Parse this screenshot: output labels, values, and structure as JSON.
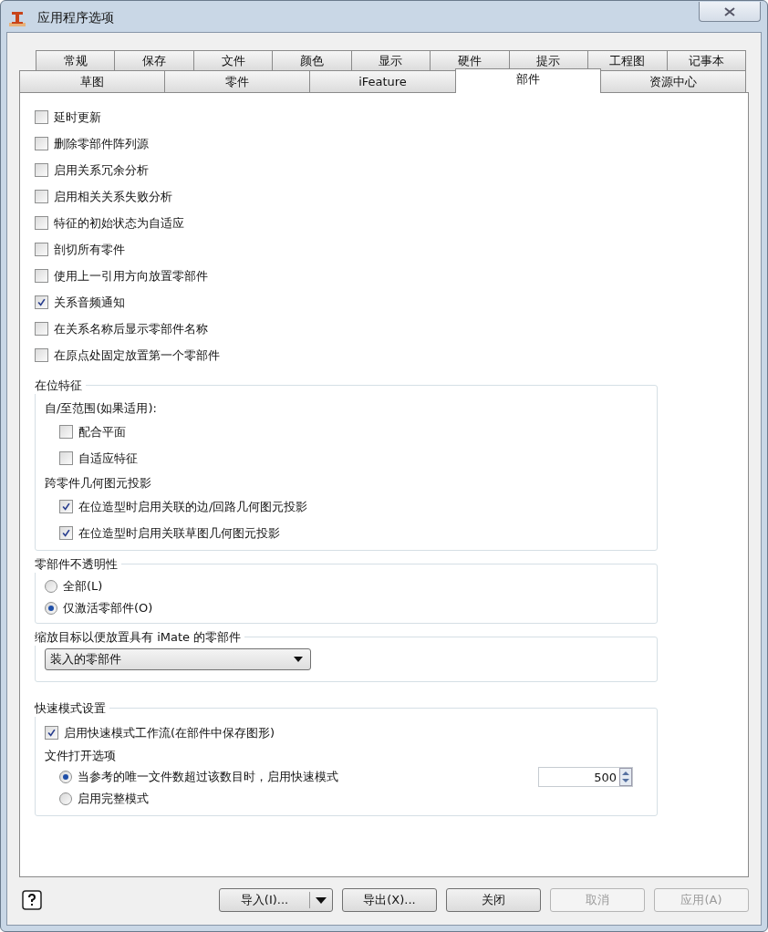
{
  "window": {
    "title": "应用程序选项"
  },
  "tab_rows": [
    [
      {
        "label": "常规",
        "selected": false
      },
      {
        "label": "保存",
        "selected": false
      },
      {
        "label": "文件",
        "selected": false
      },
      {
        "label": "颜色",
        "selected": false
      },
      {
        "label": "显示",
        "selected": false
      },
      {
        "label": "硬件",
        "selected": false
      },
      {
        "label": "提示",
        "selected": false
      },
      {
        "label": "工程图",
        "selected": false
      },
      {
        "label": "记事本",
        "selected": false
      }
    ],
    [
      {
        "label": "草图",
        "selected": false
      },
      {
        "label": "零件",
        "selected": false
      },
      {
        "label": "iFeature",
        "selected": false
      },
      {
        "label": "部件",
        "selected": true
      },
      {
        "label": "资源中心",
        "selected": false
      }
    ]
  ],
  "options": [
    {
      "label": "延时更新",
      "checked": false
    },
    {
      "label": "删除零部件阵列源",
      "checked": false
    },
    {
      "label": "启用关系冗余分析",
      "checked": false
    },
    {
      "label": "启用相关关系失败分析",
      "checked": false
    },
    {
      "label": "特征的初始状态为自适应",
      "checked": false
    },
    {
      "label": "剖切所有零件",
      "checked": false
    },
    {
      "label": "使用上一引用方向放置零部件",
      "checked": false
    },
    {
      "label": "关系音频通知",
      "checked": true
    },
    {
      "label": "在关系名称后显示零部件名称",
      "checked": false
    },
    {
      "label": "在原点处固定放置第一个零部件",
      "checked": false
    }
  ],
  "in_place_features": {
    "title": "在位特征",
    "extent_label": "自/至范围(如果适用):",
    "extent_options": [
      {
        "label": "配合平面",
        "checked": false
      },
      {
        "label": "自适应特征",
        "checked": false
      }
    ],
    "projection_label": "跨零件几何图元投影",
    "projection_options": [
      {
        "label": "在位造型时启用关联的边/回路几何图元投影",
        "checked": true
      },
      {
        "label": "在位造型时启用关联草图几何图元投影",
        "checked": true
      }
    ]
  },
  "opacity": {
    "title": "零部件不透明性",
    "options": [
      {
        "label": "全部(L)",
        "selected": false
      },
      {
        "label": "仅激活零部件(O)",
        "selected": true
      }
    ]
  },
  "zoom_target": {
    "title": "缩放目标以便放置具有 iMate 的零部件",
    "dropdown": {
      "value": "装入的零部件"
    }
  },
  "express_mode": {
    "title": "快速模式设置",
    "enable": {
      "label": "启用快速模式工作流(在部件中保存图形)",
      "checked": true
    },
    "file_open_label": "文件打开选项",
    "options": [
      {
        "label": "当参考的唯一文件数超过该数目时，启用快速模式",
        "selected": true,
        "threshold": "500"
      },
      {
        "label": "启用完整模式",
        "selected": false
      }
    ]
  },
  "buttons": [
    {
      "kind": "help"
    },
    {
      "kind": "split",
      "label": "导入(I)...",
      "disabled": false
    },
    {
      "kind": "normal",
      "label": "导出(X)...",
      "disabled": false
    },
    {
      "kind": "normal",
      "label": "关闭",
      "disabled": false
    },
    {
      "kind": "normal",
      "label": "取消",
      "disabled": true
    },
    {
      "kind": "normal",
      "label": "应用(A)",
      "disabled": true
    }
  ]
}
